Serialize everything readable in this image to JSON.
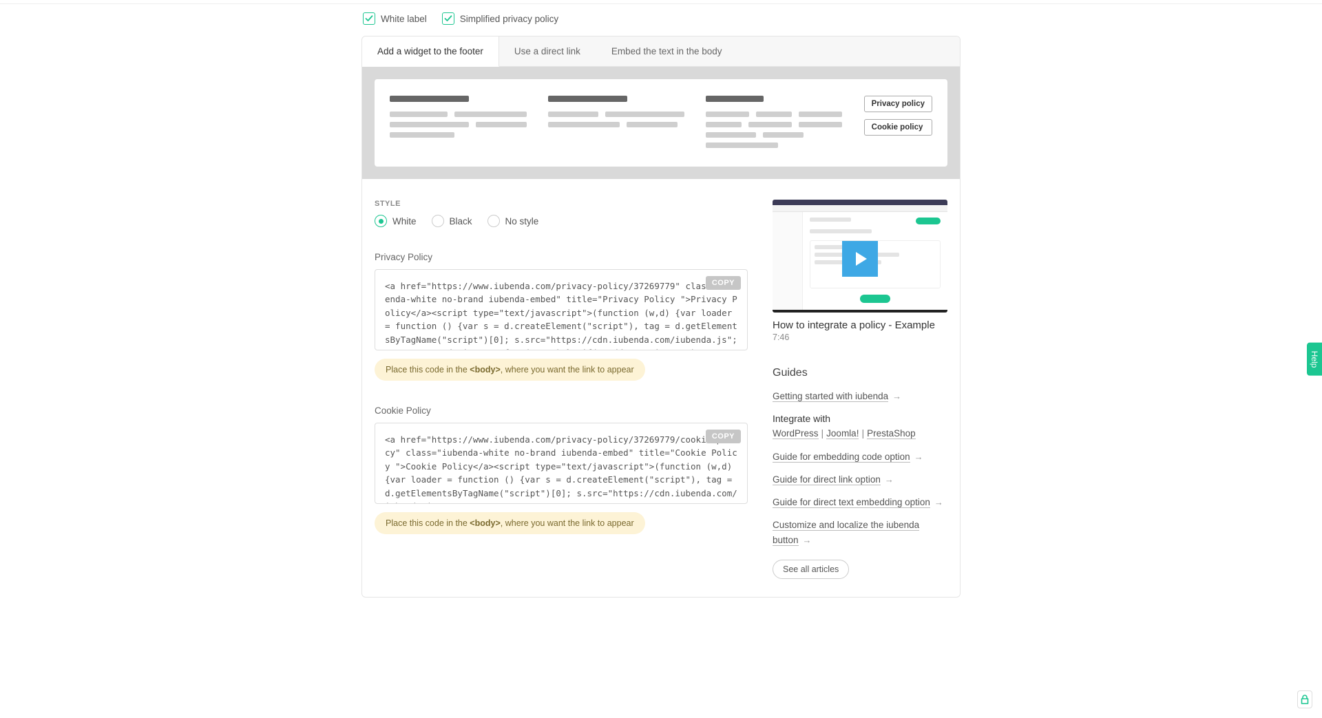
{
  "checkboxes": {
    "white_label": "White label",
    "simplified": "Simplified privacy policy"
  },
  "tabs": {
    "widget": "Add a widget to the footer",
    "direct_link": "Use a direct link",
    "embed_body": "Embed the text in the body"
  },
  "preview": {
    "btn_privacy": "Privacy policy",
    "btn_cookie": "Cookie policy"
  },
  "style": {
    "label": "STYLE",
    "options": {
      "white": "White",
      "black": "Black",
      "none": "No style"
    }
  },
  "sections": {
    "privacy": {
      "title": "Privacy Policy",
      "code": "<a href=\"https://www.iubenda.com/privacy-policy/37269779\" class=\"iubenda-white no-brand iubenda-embed\" title=\"Privacy Policy \">Privacy Policy</a><script type=\"text/javascript\">(function (w,d) {var loader = function () {var s = d.createElement(\"script\"), tag = d.getElementsByTagName(\"script\")[0]; s.src=\"https://cdn.iubenda.com/iubenda.js\"; tag.parentNode.insertBefore(s,tag);}; if(w.addEventListener)",
      "hint_pre": "Place this code in the ",
      "hint_bold": "<body>",
      "hint_post": ", where you want the link to appear"
    },
    "cookie": {
      "title": "Cookie Policy",
      "code": "<a href=\"https://www.iubenda.com/privacy-policy/37269779/cookie-policy\" class=\"iubenda-white no-brand iubenda-embed\" title=\"Cookie Policy \">Cookie Policy</a><script type=\"text/javascript\">(function (w,d) {var loader = function () {var s = d.createElement(\"script\"), tag = d.getElementsByTagName(\"script\")[0]; s.src=\"https://cdn.iubenda.com/iubenda.js\";",
      "hint_pre": "Place this code in the ",
      "hint_bold": "<body>",
      "hint_post": ", where you want the link to appear"
    }
  },
  "copy_label": "COPY",
  "video": {
    "title": "How to integrate a policy - Example",
    "duration": "7:46"
  },
  "guides": {
    "title": "Guides",
    "links": {
      "getting_started": "Getting started with iubenda",
      "integrate_prefix": "Integrate with ",
      "wordpress": "WordPress",
      "joomla": "Joomla!",
      "prestashop": "PrestaShop",
      "embed_code": "Guide for embedding code option",
      "direct_link": "Guide for direct link option",
      "direct_text": "Guide for direct text embedding option",
      "customize": "Customize and localize the iubenda button"
    },
    "see_all": "See all articles"
  },
  "help_tab": "Help"
}
